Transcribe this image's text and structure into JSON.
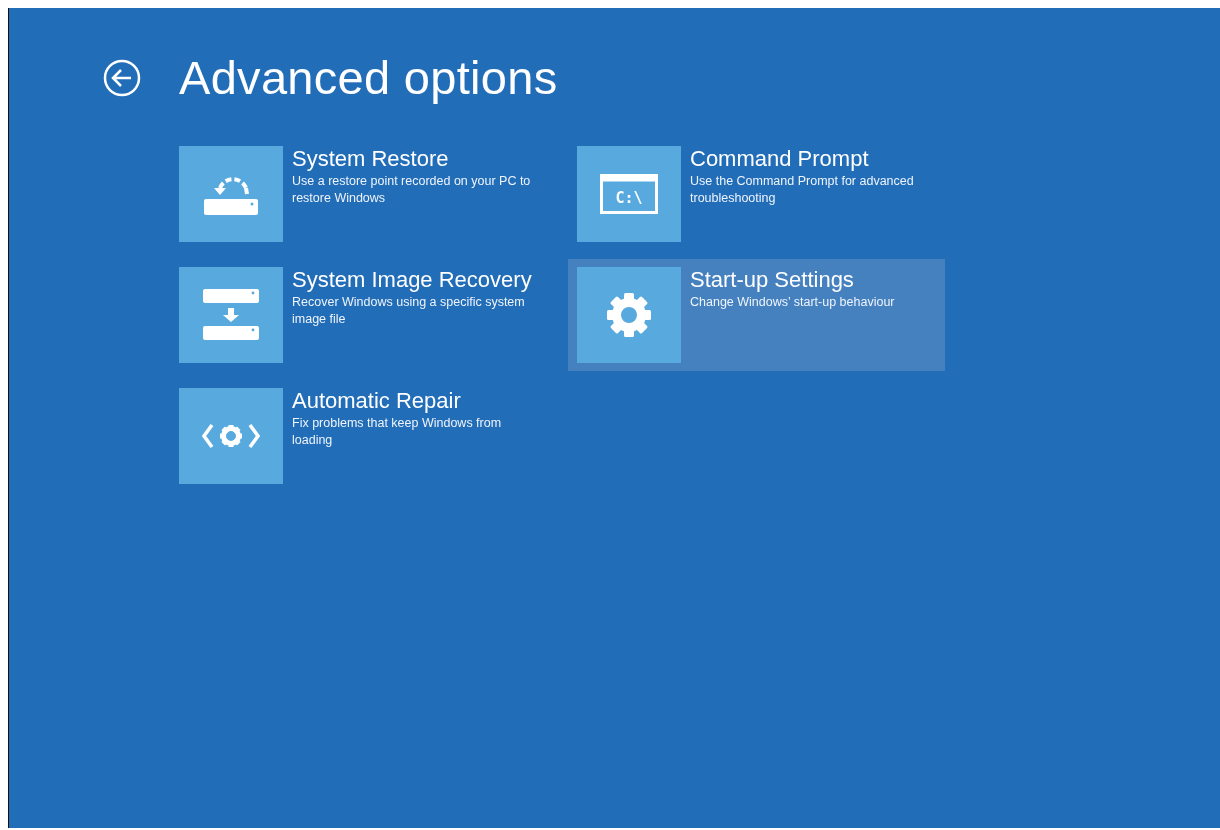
{
  "header": {
    "title": "Advanced options"
  },
  "columns": [
    {
      "items": [
        {
          "kind": "restore",
          "title": "System Restore",
          "description": "Use a restore point recorded on your PC to restore Windows",
          "selected": false
        },
        {
          "kind": "image",
          "title": "System Image Recovery",
          "description": "Recover Windows using a specific system image file",
          "selected": false
        },
        {
          "kind": "repair",
          "title": "Automatic Repair",
          "description": "Fix problems that keep Windows from loading",
          "selected": false
        }
      ]
    },
    {
      "items": [
        {
          "kind": "command",
          "title": "Command Prompt",
          "description": "Use the Command Prompt for advanced troubleshooting",
          "icon_text": "C:\\",
          "selected": false
        },
        {
          "kind": "startup",
          "title": "Start-up Settings",
          "description": "Change Windows’ start-up behaviour",
          "selected": true
        }
      ]
    }
  ]
}
